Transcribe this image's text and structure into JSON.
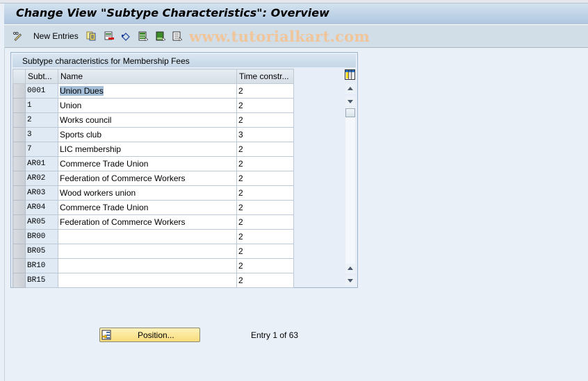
{
  "window": {
    "title": "Change View \"Subtype Characteristics\": Overview"
  },
  "toolbar": {
    "items": [
      {
        "name": "display-change-icon",
        "label": ""
      },
      {
        "name": "new-entries",
        "label": "New Entries"
      },
      {
        "name": "copy-as-icon",
        "label": ""
      },
      {
        "name": "delete-icon",
        "label": ""
      },
      {
        "name": "undo-change-icon",
        "label": ""
      },
      {
        "name": "select-all-icon",
        "label": ""
      },
      {
        "name": "select-block-icon",
        "label": ""
      },
      {
        "name": "deselect-all-icon",
        "label": ""
      }
    ],
    "watermark": "www.tutorialkart.com"
  },
  "table": {
    "title": "Subtype characteristics for Membership Fees",
    "columns": [
      "Subt...",
      "Name",
      "Time constr..."
    ],
    "rows": [
      {
        "subtype": "0001",
        "name": "Union Dues",
        "time_constraint": "2",
        "highlighted": true
      },
      {
        "subtype": "1",
        "name": "Union",
        "time_constraint": "2"
      },
      {
        "subtype": "2",
        "name": "Works council",
        "time_constraint": "2"
      },
      {
        "subtype": "3",
        "name": "Sports club",
        "time_constraint": "3"
      },
      {
        "subtype": "7",
        "name": "LIC membership",
        "time_constraint": "2"
      },
      {
        "subtype": "AR01",
        "name": "Commerce Trade Union",
        "time_constraint": "2"
      },
      {
        "subtype": "AR02",
        "name": "Federation of Commerce Workers",
        "time_constraint": "2"
      },
      {
        "subtype": "AR03",
        "name": "Wood workers union",
        "time_constraint": "2"
      },
      {
        "subtype": "AR04",
        "name": "Commerce Trade Union",
        "time_constraint": "2"
      },
      {
        "subtype": "AR05",
        "name": "Federation of Commerce Workers",
        "time_constraint": "2"
      },
      {
        "subtype": "BR00",
        "name": "",
        "time_constraint": "2"
      },
      {
        "subtype": "BR05",
        "name": "",
        "time_constraint": "2"
      },
      {
        "subtype": "BR10",
        "name": "",
        "time_constraint": "2"
      },
      {
        "subtype": "BR15",
        "name": "",
        "time_constraint": "2"
      }
    ]
  },
  "footer": {
    "position_button": "Position...",
    "entry_status": "Entry 1 of 63"
  },
  "colors": {
    "title_gradient_top": "#d3e2ef",
    "title_gradient_bottom": "#aec6de",
    "toolbar_bg": "#d1dde7",
    "background": "#eaf0f8",
    "selection_highlight": "#a6bfd8",
    "button_yellow": "#f8dc7c",
    "watermark": "#f0c59a"
  }
}
